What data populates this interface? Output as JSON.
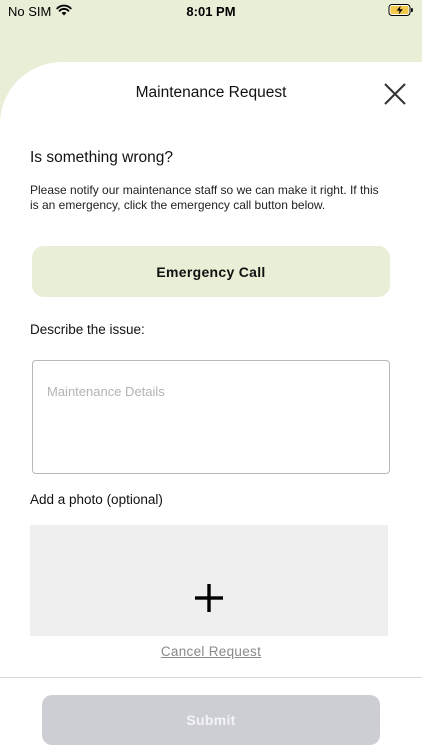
{
  "status_bar": {
    "carrier": "No SIM",
    "time": "8:01 PM"
  },
  "sheet": {
    "title": "Maintenance Request",
    "close_icon": "close-icon"
  },
  "form": {
    "heading": "Is something wrong?",
    "intro": "Please notify our maintenance staff so we can make it right. If this is an emergency, click the emergency call button below.",
    "emergency_button": "Emergency Call",
    "describe_label": "Describe the issue:",
    "details_placeholder": "Maintenance Details",
    "details_value": "",
    "photo_label": "Add a photo (optional)",
    "photo_icon": "plus-icon",
    "cancel_link": "Cancel Request",
    "submit_button": "Submit"
  },
  "colors": {
    "accent": "#e9eed6",
    "submit_disabled": "#cdced4",
    "cancel_text": "#8a8a8a"
  }
}
